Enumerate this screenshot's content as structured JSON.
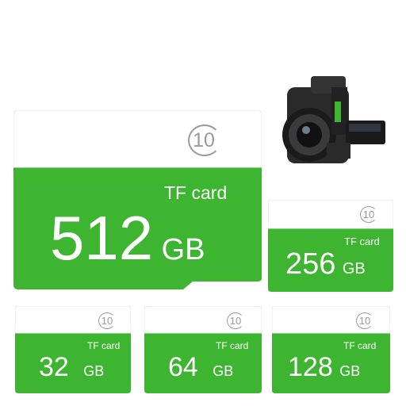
{
  "colors": {
    "green": "#3db531",
    "white": "#ffffff",
    "badge_gray": "#9a9a9a"
  },
  "icons": {
    "speed_class": "class-10-badge",
    "camera": "camera-with-card-photo"
  },
  "cards": [
    {
      "key": "512",
      "badge": "10",
      "label": "TF card",
      "capacity": "512",
      "unit": "GB"
    },
    {
      "key": "256",
      "badge": "10",
      "label": "TF card",
      "capacity": "256",
      "unit": "GB"
    },
    {
      "key": "32",
      "badge": "10",
      "label": "TF card",
      "capacity": "32",
      "unit": "GB"
    },
    {
      "key": "64",
      "badge": "10",
      "label": "TF card",
      "capacity": "64",
      "unit": "GB"
    },
    {
      "key": "128",
      "badge": "10",
      "label": "TF card",
      "capacity": "128",
      "unit": "GB"
    }
  ]
}
